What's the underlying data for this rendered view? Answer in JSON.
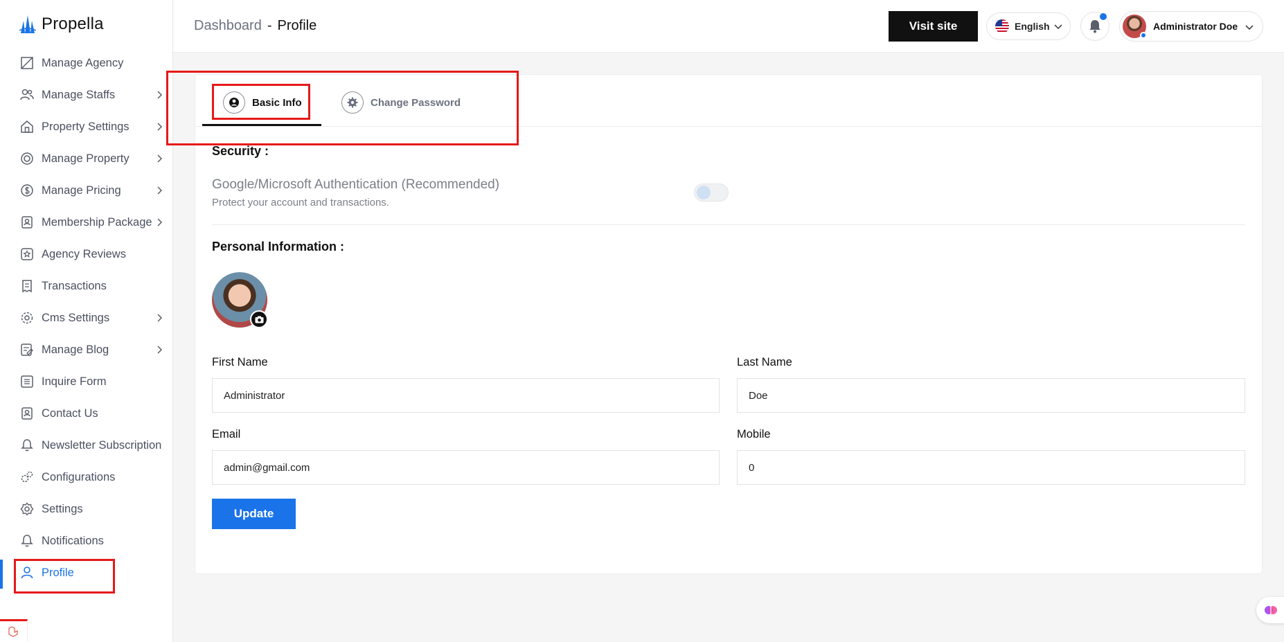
{
  "brand": {
    "name": "Propella"
  },
  "sidebar": {
    "items": [
      {
        "label": "Manage Agency",
        "icon": "agency-icon",
        "has_children": false
      },
      {
        "label": "Manage Staffs",
        "icon": "users-icon",
        "has_children": true
      },
      {
        "label": "Property Settings",
        "icon": "home-icon",
        "has_children": true
      },
      {
        "label": "Manage Property",
        "icon": "property-icon",
        "has_children": true
      },
      {
        "label": "Manage Pricing",
        "icon": "pricing-icon",
        "has_children": true
      },
      {
        "label": "Membership Package",
        "icon": "membership-icon",
        "has_children": true
      },
      {
        "label": "Agency Reviews",
        "icon": "star-icon",
        "has_children": false
      },
      {
        "label": "Transactions",
        "icon": "receipt-icon",
        "has_children": false
      },
      {
        "label": "Cms Settings",
        "icon": "gear-icon",
        "has_children": true
      },
      {
        "label": "Manage Blog",
        "icon": "blog-icon",
        "has_children": true
      },
      {
        "label": "Inquire Form",
        "icon": "list-icon",
        "has_children": false
      },
      {
        "label": "Contact Us",
        "icon": "contact-icon",
        "has_children": false
      },
      {
        "label": "Newsletter Subscription",
        "icon": "bell-icon",
        "has_children": false
      },
      {
        "label": "Configurations",
        "icon": "cogs-icon",
        "has_children": false
      },
      {
        "label": "Settings",
        "icon": "settings-icon",
        "has_children": false
      },
      {
        "label": "Notifications",
        "icon": "bell-icon",
        "has_children": false
      },
      {
        "label": "Profile",
        "icon": "user-icon",
        "has_children": false,
        "active": true
      }
    ]
  },
  "header": {
    "breadcrumb_root": "Dashboard",
    "breadcrumb_sep": "-",
    "breadcrumb_current": "Profile",
    "visit_site": "Visit site",
    "language": "English",
    "user_name": "Administrator Doe"
  },
  "tabs": {
    "basic_info": "Basic Info",
    "change_password": "Change Password"
  },
  "security": {
    "title": "Security :",
    "auth_title": "Google/Microsoft Authentication (Recommended)",
    "auth_desc": "Protect your account and transactions.",
    "enabled": false
  },
  "personal": {
    "title": "Personal Information :",
    "first_name_label": "First Name",
    "first_name": "Administrator",
    "last_name_label": "Last Name",
    "last_name": "Doe",
    "email_label": "Email",
    "email": "admin@gmail.com",
    "mobile_label": "Mobile",
    "mobile": "0",
    "update": "Update"
  },
  "colors": {
    "accent": "#1a73e8",
    "highlight": "#e61919",
    "dark": "#111111"
  }
}
